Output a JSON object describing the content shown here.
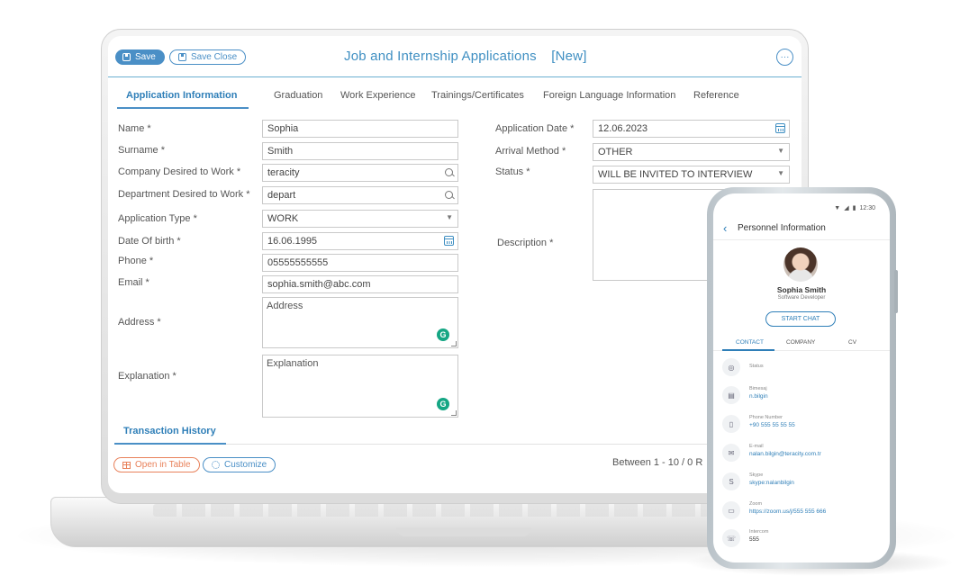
{
  "form": {
    "save_label": "Save",
    "save_close_label": "Save Close",
    "title": "Job and Internship Applications",
    "title_badge": "[New]",
    "more_icon": "···",
    "tabs": [
      {
        "label": "Application Information"
      },
      {
        "label": "Graduation"
      },
      {
        "label": "Work Experience"
      },
      {
        "label": "Trainings/Certificates"
      },
      {
        "label": "Foreign Language Information"
      },
      {
        "label": "Reference"
      }
    ],
    "left": {
      "name": {
        "label": "Name *",
        "value": "Sophia"
      },
      "surname": {
        "label": "Surname *",
        "value": "Smith"
      },
      "company": {
        "label": "Company Desired to Work *",
        "value": "teracity"
      },
      "department": {
        "label": "Department Desired to Work *",
        "value": "depart"
      },
      "app_type": {
        "label": "Application Type *",
        "value": "WORK"
      },
      "dob": {
        "label": "Date Of birth *",
        "value": "16.06.1995"
      },
      "phone": {
        "label": "Phone *",
        "value": "05555555555"
      },
      "email": {
        "label": "Email *",
        "value": "sophia.smith@abc.com"
      },
      "address": {
        "label": "Address *",
        "placeholder": "Address"
      },
      "explanation": {
        "label": "Explanation *",
        "placeholder": "Explanation"
      }
    },
    "right": {
      "app_date": {
        "label": "Application Date *",
        "value": "12.06.2023"
      },
      "arrival": {
        "label": "Arrival Method *",
        "value": "OTHER"
      },
      "status": {
        "label": "Status *",
        "value": "WILL BE INVITED TO INTERVIEW"
      },
      "description": {
        "label": "Description *"
      }
    },
    "grammarly_glyph": "G",
    "section_title": "Transaction History",
    "open_table_label": "Open in Table",
    "customize_label": "Customize",
    "pager": "Between 1 - 10  /  0 R"
  },
  "phone": {
    "status_time": "12:30",
    "header_title": "Personnel Information",
    "name": "Sophia Smith",
    "role": "Software Developer",
    "chat_label": "START CHAT",
    "tabs": [
      {
        "label": "CONTACT"
      },
      {
        "label": "COMPANY"
      },
      {
        "label": "CV"
      }
    ],
    "rows": [
      {
        "icon": "status-icon",
        "key": "Status",
        "value": ""
      },
      {
        "icon": "message-icon",
        "key": "Bimesaj",
        "value": "n.bilgin"
      },
      {
        "icon": "phone-icon",
        "key": "Phone Number",
        "value": "+90 555 55 55 55"
      },
      {
        "icon": "mail-icon",
        "key": "E-mail",
        "value": "nalan.bilgin@teracity.com.tr"
      },
      {
        "icon": "skype-icon",
        "key": "Skype",
        "value": "skype:nalanbilgin"
      },
      {
        "icon": "video-icon",
        "key": "Zoom",
        "value": "https://zoom.us/j/555 555 666"
      },
      {
        "icon": "intercom-icon",
        "key": "Intercom",
        "value": "555"
      }
    ]
  },
  "colors": {
    "accent": "#4a8fc6",
    "accent_dark": "#2f7fb8",
    "orange": "#e8815a",
    "grammarly": "#15a684"
  }
}
